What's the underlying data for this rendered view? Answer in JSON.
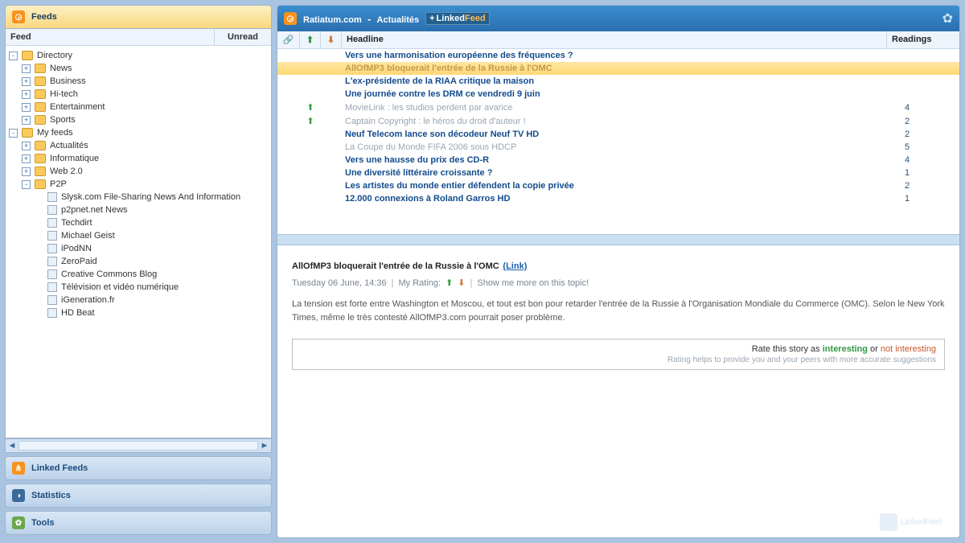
{
  "sidebar": {
    "feeds_label": "Feeds",
    "col_feed": "Feed",
    "col_unread": "Unread",
    "linked_feeds": "Linked Feeds",
    "statistics": "Statistics",
    "tools": "Tools"
  },
  "tree": {
    "directory": {
      "label": "Directory",
      "children": [
        "News",
        "Business",
        "Hi-tech",
        "Entertainment",
        "Sports"
      ]
    },
    "myfeeds": {
      "label": "My feeds",
      "children": [
        {
          "label": "Actualités"
        },
        {
          "label": "Informatique"
        },
        {
          "label": "Web 2.0"
        },
        {
          "label": "P2P",
          "children": [
            "Slysk.com File-Sharing News And Information",
            "p2pnet.net News",
            "Techdirt",
            "Michael Geist",
            "iPodNN",
            "ZeroPaid",
            "Creative Commons Blog",
            "Télévision et vidéo numérique",
            "iGeneration.fr",
            "HD Beat"
          ]
        }
      ]
    }
  },
  "header": {
    "source": "Ratiatum.com",
    "section": "Actualités",
    "badge_brand": "Linked",
    "badge_brand2": "Feed",
    "col_link": "",
    "col_headline": "Headline",
    "col_readings": "Readings"
  },
  "articles": [
    {
      "headline": "Vers une harmonisation européenne des fréquences ?",
      "state": "bold",
      "readings": ""
    },
    {
      "headline": "AllOfMP3 bloquerait l'entrée de la Russie à l'OMC",
      "state": "sel",
      "readings": ""
    },
    {
      "headline": "L'ex-présidente de la RIAA critique la maison",
      "state": "bold",
      "readings": ""
    },
    {
      "headline": "Une journée contre les DRM ce vendredi 9 juin",
      "state": "bold",
      "readings": ""
    },
    {
      "headline": "MovieLink : les studios perdent par avarice",
      "state": "grey",
      "vote": "up",
      "readings": "4"
    },
    {
      "headline": "Captain Copyright : le héros du droit d'auteur !",
      "state": "grey",
      "vote": "up",
      "readings": "2"
    },
    {
      "headline": "Neuf Telecom lance son décodeur Neuf TV HD",
      "state": "bold",
      "readings": "2"
    },
    {
      "headline": "La Coupe du Monde FIFA 2006 sous HDCP",
      "state": "grey",
      "readings": "5"
    },
    {
      "headline": "Vers une hausse du prix des CD-R",
      "state": "bold",
      "readings": "4"
    },
    {
      "headline": "Une diversité littéraire croissante ?",
      "state": "bold",
      "readings": "1"
    },
    {
      "headline": "Les artistes du monde entier défendent la copie privée",
      "state": "bold",
      "readings": "2"
    },
    {
      "headline": "12.000 connexions à Roland Garros HD",
      "state": "bold",
      "readings": "1"
    }
  ],
  "article": {
    "title": "AllOfMP3 bloquerait l'entrée de la Russie à l'OMC",
    "link_label": "(Link)",
    "date": "Tuesday 06 June, 14:36",
    "my_rating": "My Rating:",
    "show_more": "Show me more on this topic!",
    "body": "La tension est forte entre Washington et Moscou, et tout est bon pour retarder l'entrée de la Russie à l'Organisation Mondiale du Commerce (OMC). Selon le New York Times, même le très contesté AllOfMP3.com pourrait poser problème.",
    "rate_prefix": "Rate this story as ",
    "rate_interesting": "interesting",
    "rate_or": " or ",
    "rate_not": "not interesting",
    "rate_help": "Rating helps to provide you and your peers with more accurate suggestions"
  },
  "watermark": "LinkedFeed"
}
